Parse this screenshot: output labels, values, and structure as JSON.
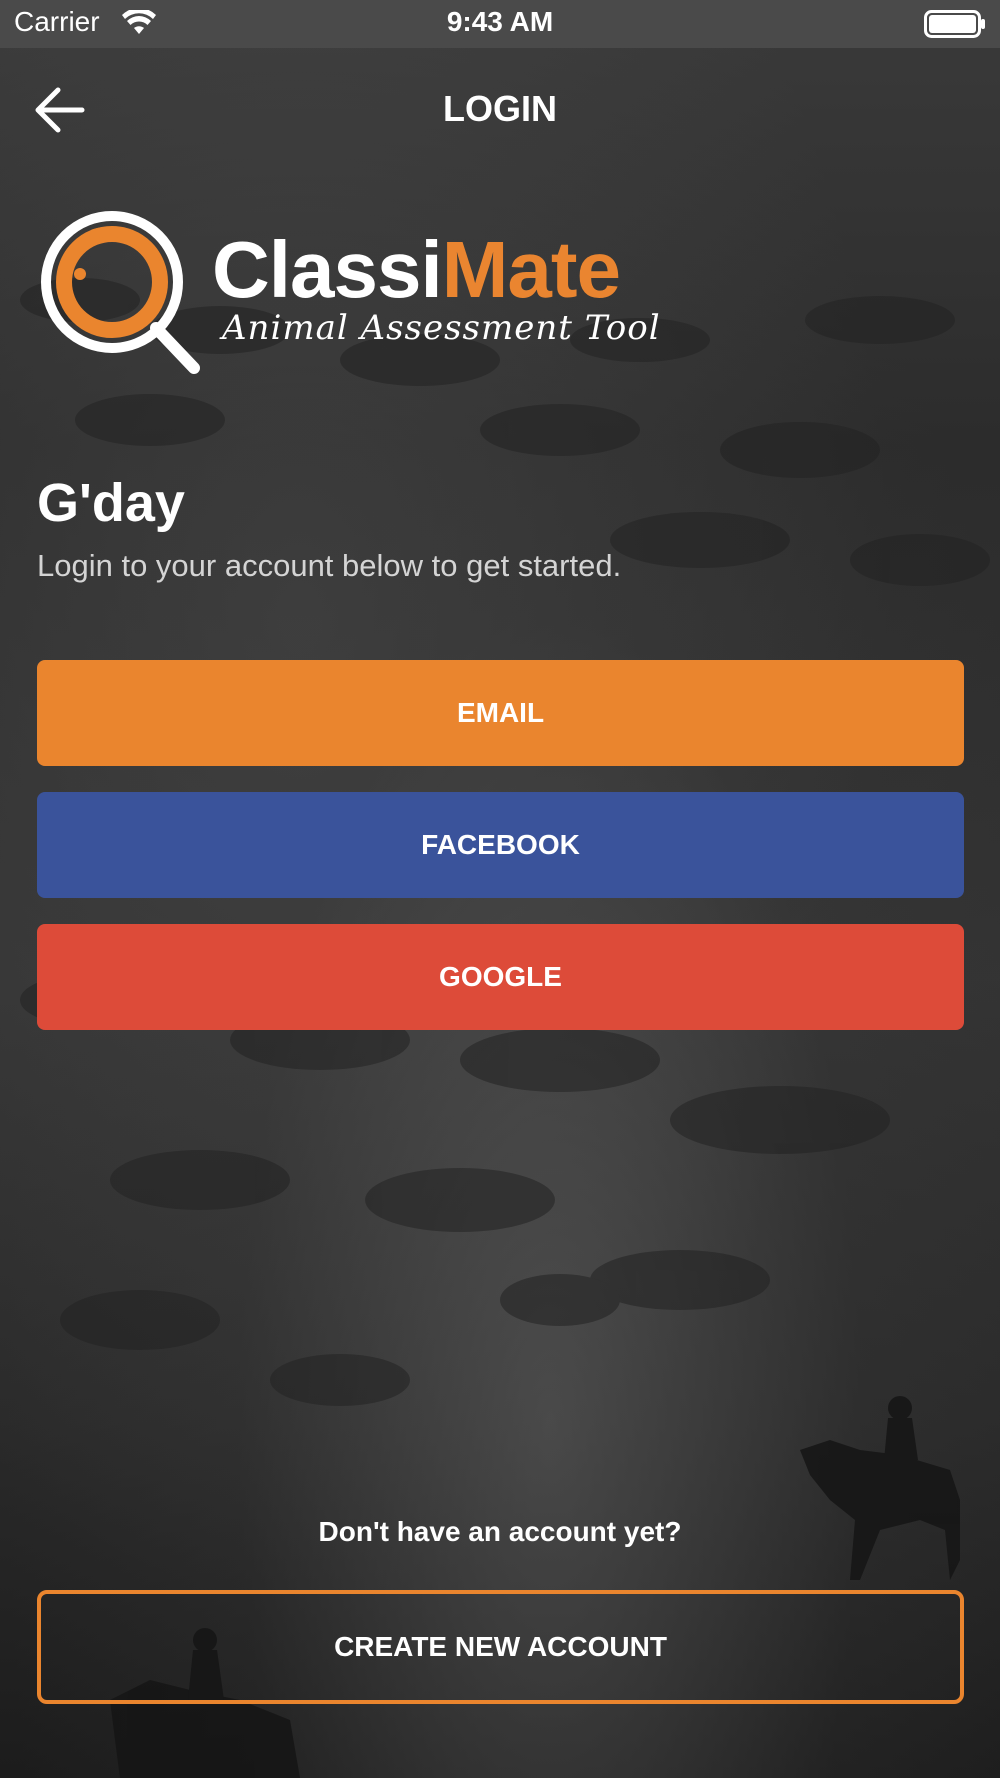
{
  "status_bar": {
    "carrier": "Carrier",
    "time": "9:43 AM",
    "wifi_icon": "wifi-icon",
    "battery_icon": "battery-icon"
  },
  "nav": {
    "title": "LOGIN",
    "back_icon": "arrow-left-icon"
  },
  "logo": {
    "part1": "Classi",
    "part2": "Mate",
    "tagline": "Animal Assessment Tool",
    "mark_icon": "magnifier-logo-icon"
  },
  "greeting": {
    "title": "G'day",
    "subtitle": "Login to your account below to get started."
  },
  "login_options": {
    "email": "EMAIL",
    "facebook": "FACEBOOK",
    "google": "GOOGLE"
  },
  "signup": {
    "prompt": "Don't have an account yet?",
    "button": "CREATE NEW ACCOUNT"
  },
  "colors": {
    "accent": "#ea852e",
    "facebook": "#3a539b",
    "google": "#dd4b39",
    "status_bar": "#4a4a4a"
  }
}
